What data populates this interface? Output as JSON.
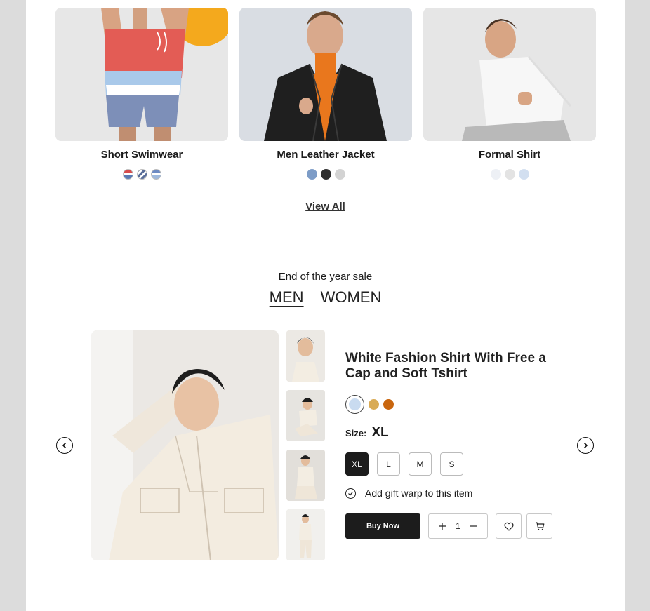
{
  "products": [
    {
      "name": "Short Swimwear",
      "swatches": [
        "striped-red-blue",
        "striped-navy-white",
        "striped-light-blue"
      ],
      "image": "man-in-striped-swim-shorts"
    },
    {
      "name": "Men Leather Jacket",
      "swatches": [
        "#7d9cc7",
        "#2f2f2f",
        "#d3d3d3"
      ],
      "image": "man-in-black-leather-jacket"
    },
    {
      "name": "Formal Shirt",
      "swatches": [
        "#edf0f5",
        "#e3e3e3",
        "#d2dff0"
      ],
      "image": "man-in-white-shirt"
    }
  ],
  "view_all_label": "View All",
  "sale": {
    "heading": "End of the year sale",
    "tabs": [
      {
        "label": "MEN",
        "active": true
      },
      {
        "label": "WOMEN",
        "active": false
      }
    ]
  },
  "featured": {
    "title": "White Fashion Shirt With Free a Cap and Soft Tshirt",
    "colors": [
      {
        "hex": "#c9dbf0",
        "selected": true
      },
      {
        "hex": "#d9ab55",
        "selected": false
      },
      {
        "hex": "#c9660e",
        "selected": false
      }
    ],
    "size_label": "Size:",
    "selected_size": "XL",
    "sizes": [
      "XL",
      "L",
      "M",
      "S"
    ],
    "gift_label": "Add gift warp to this item",
    "buy_label": "Buy Now",
    "quantity": "1"
  },
  "colors": {
    "page_bg": "#dcdcdc",
    "accent": "#1c1c1c"
  },
  "icons": [
    "chevron-left-icon",
    "chevron-right-icon",
    "check-icon",
    "plus-icon",
    "minus-icon",
    "heart-icon",
    "cart-icon"
  ]
}
